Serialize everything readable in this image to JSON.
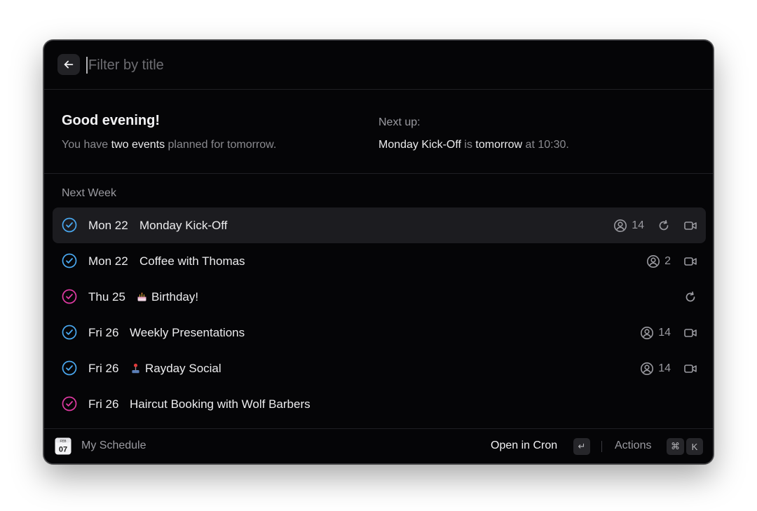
{
  "search": {
    "placeholder": "Filter by title",
    "value": ""
  },
  "summary": {
    "greeting": "Good evening!",
    "line_prefix": "You have ",
    "line_highlight": "two events",
    "line_suffix": " planned for tomorrow.",
    "next_label": "Next up:",
    "next_event": "Monday Kick-Off",
    "next_is": " is ",
    "next_when": "tomorrow",
    "next_time": " at 10:30."
  },
  "section": {
    "title": "Next Week"
  },
  "events": [
    {
      "date": "Mon 22",
      "title": "Monday Kick-Off",
      "emoji": "",
      "check_color": "#4aa8f0",
      "attendees": "14",
      "recurring": true,
      "video": true,
      "selected": true
    },
    {
      "date": "Mon 22",
      "title": "Coffee with Thomas",
      "emoji": "",
      "check_color": "#4aa8f0",
      "attendees": "2",
      "recurring": false,
      "video": true,
      "selected": false
    },
    {
      "date": "Thu 25",
      "title": "Birthday!",
      "emoji": "birthday-cake-icon",
      "check_color": "#e03aa3",
      "attendees": "",
      "recurring": true,
      "video": false,
      "selected": false
    },
    {
      "date": "Fri 26",
      "title": "Weekly Presentations",
      "emoji": "",
      "check_color": "#4aa8f0",
      "attendees": "14",
      "recurring": false,
      "video": true,
      "selected": false
    },
    {
      "date": "Fri 26",
      "title": "Rayday Social",
      "emoji": "joystick-icon",
      "check_color": "#4aa8f0",
      "attendees": "14",
      "recurring": false,
      "video": true,
      "selected": false
    },
    {
      "date": "Fri 26",
      "title": "Haircut Booking with Wolf Barbers",
      "emoji": "",
      "check_color": "#e03aa3",
      "attendees": "",
      "recurring": false,
      "video": false,
      "selected": false
    }
  ],
  "footer": {
    "calendar_month": "FEB",
    "calendar_day": "07",
    "app_name": "My Schedule",
    "open_label": "Open in Cron",
    "open_key": "↵",
    "actions_label": "Actions",
    "actions_key_1": "⌘",
    "actions_key_2": "K"
  },
  "colors": {
    "background": "#050507",
    "selected_row": "#1c1c20",
    "accent_blue": "#4aa8f0",
    "accent_pink": "#e03aa3"
  }
}
